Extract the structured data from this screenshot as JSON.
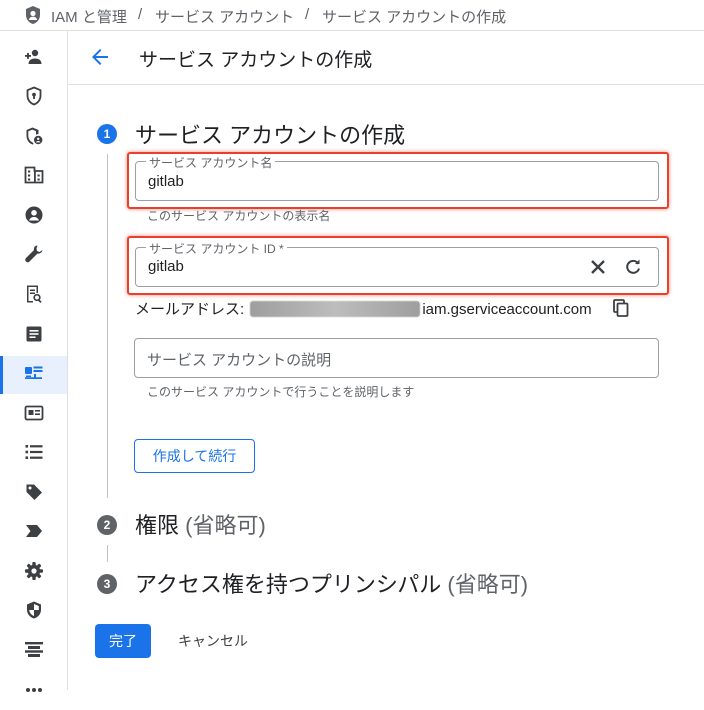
{
  "breadcrumb": {
    "product": "IAM と管理",
    "separator": "/",
    "section": "サービス アカウント",
    "current": "サービス アカウントの作成"
  },
  "sidebar": {
    "items": [
      {
        "icon": "person-add-icon"
      },
      {
        "icon": "shield-lock-icon"
      },
      {
        "icon": "shield-person-icon"
      },
      {
        "icon": "domain-icon"
      },
      {
        "icon": "account-circle-icon"
      },
      {
        "icon": "wrench-icon"
      },
      {
        "icon": "receipt-search-icon"
      },
      {
        "icon": "document-icon"
      },
      {
        "icon": "service-account-icon",
        "active": true
      },
      {
        "icon": "id-card-icon"
      },
      {
        "icon": "list-icon"
      },
      {
        "icon": "tag-icon"
      },
      {
        "icon": "label-arrow-icon"
      },
      {
        "icon": "settings-gear-icon"
      },
      {
        "icon": "security-shield-icon"
      },
      {
        "icon": "table-rows-icon"
      },
      {
        "icon": "more-icon"
      }
    ]
  },
  "header": {
    "title": "サービス アカウントの作成"
  },
  "steps": [
    {
      "number": "1",
      "title": "サービス アカウントの作成",
      "optional": ""
    },
    {
      "number": "2",
      "title": "権限",
      "optional": "(省略可)"
    },
    {
      "number": "3",
      "title": "アクセス権を持つプリンシパル",
      "optional": "(省略可)"
    }
  ],
  "form": {
    "name_field": {
      "label": "サービス アカウント名",
      "value": "gitlab",
      "hint": "このサービス アカウントの表示名"
    },
    "id_field": {
      "label": "サービス アカウント ID *",
      "value": "gitlab"
    },
    "email": {
      "label": "メールアドレス:",
      "suffix": "iam.gserviceaccount.com"
    },
    "description_field": {
      "placeholder": "サービス アカウントの説明",
      "hint": "このサービス アカウントで行うことを説明します"
    },
    "create_continue_label": "作成して続行"
  },
  "footer": {
    "done_label": "完了",
    "cancel_label": "キャンセル"
  },
  "colors": {
    "accent": "#1a73e8",
    "highlight": "#e8402a",
    "step_inactive": "#5f6368"
  }
}
